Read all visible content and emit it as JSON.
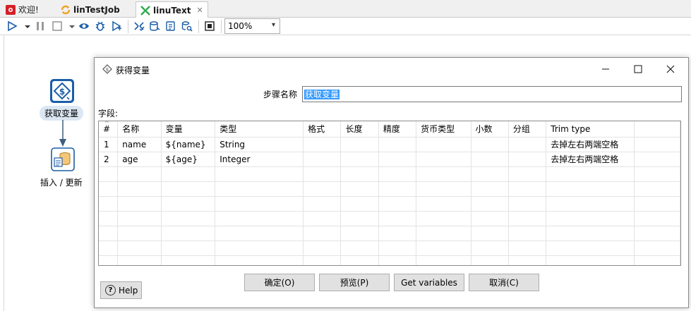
{
  "tabs": [
    {
      "label": "欢迎!",
      "icon": "spoon-welcome-icon",
      "active": false
    },
    {
      "label": "linTestJob",
      "icon": "job-icon",
      "active": false
    },
    {
      "label": "linuText",
      "icon": "transformation-icon",
      "active": true
    }
  ],
  "toolbar": {
    "zoom_value": "100%",
    "icons": [
      "run-icon",
      "run-options-icon",
      "pause-icon",
      "stop-icon",
      "stop-options-icon",
      "preview-icon",
      "debug-icon",
      "replay-icon",
      "verify-icon",
      "impact-icon",
      "sql-icon",
      "explore-db-icon",
      "show-results-icon"
    ]
  },
  "canvas": {
    "steps": [
      {
        "label": "获取变量",
        "icon": "get-variables-step-icon"
      },
      {
        "label": "插入 / 更新",
        "icon": "insert-update-step-icon"
      }
    ]
  },
  "dialog": {
    "title": "获得变量",
    "step_name_label": "步骤名称",
    "step_name_value": "获取变量",
    "fields_label": "字段:",
    "columns": [
      "#",
      "名称",
      "变量",
      "类型",
      "格式",
      "长度",
      "精度",
      "货币类型",
      "小数",
      "分组",
      "Trim type"
    ],
    "rows": [
      [
        "1",
        "name",
        "${name}",
        "String",
        "",
        "",
        "",
        "",
        "",
        "",
        "去掉左右两端空格"
      ],
      [
        "2",
        "age",
        "${age}",
        "Integer",
        "",
        "",
        "",
        "",
        "",
        "",
        "去掉左右两端空格"
      ]
    ],
    "buttons": {
      "ok": "确定(O)",
      "preview": "预览(P)",
      "get_variables": "Get variables",
      "cancel": "取消(C)"
    },
    "help_label": "Help"
  },
  "colors": {
    "accent": "#1c5ea8",
    "selection": "#3399ff",
    "step_label_bg": "#dbe7f3"
  }
}
